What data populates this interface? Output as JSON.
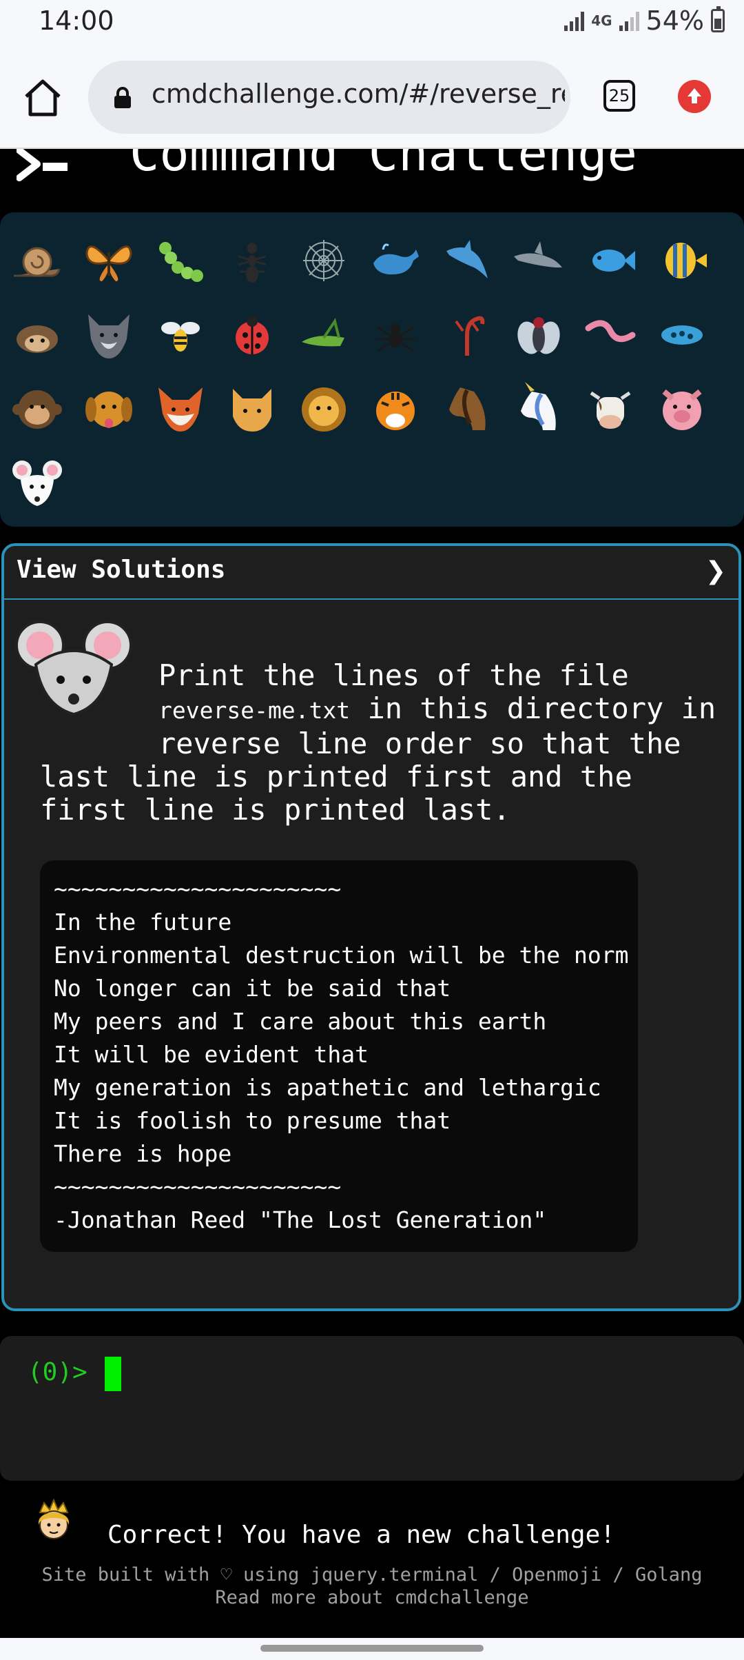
{
  "status_bar": {
    "time": "14:00",
    "network": "4G",
    "battery": "54%"
  },
  "browser": {
    "url": "cmdchallenge.com/#/reverse_reac",
    "tab_count": "25",
    "icons": [
      "home-icon",
      "lock-icon",
      "tab-switcher-icon",
      "update-icon"
    ]
  },
  "header": {
    "title": "Command Challenge"
  },
  "emoji_panel": {
    "items": [
      "snail",
      "butterfly",
      "caterpillar",
      "ant",
      "spider-web",
      "whale",
      "dolphin",
      "shark",
      "fish",
      "tropical-fish",
      "hedgehog",
      "wolf",
      "bee",
      "ladybug",
      "grasshopper",
      "spider",
      "scorpion",
      "fly",
      "worm",
      "microbe",
      "monkey",
      "dog",
      "fox",
      "cat",
      "lion",
      "tiger",
      "horse",
      "unicorn",
      "cow",
      "pig",
      "mouse"
    ]
  },
  "challenge": {
    "view_solutions": "View Solutions",
    "chevron": "❯",
    "instruction_line1": "Print the lines of the file",
    "instruction_code": "reverse-me.txt",
    "instruction_line2_rest": " in this directory in",
    "instruction_line3": "reverse line order so that the",
    "instruction_line4": "last line is printed first and the",
    "instruction_line5": "first line is printed last.",
    "file_lines": [
      "~~~~~~~~~~~~~~~~~~~~~",
      "In the future",
      "Environmental destruction will be the norm",
      "No longer can it be said that",
      "My peers and I care about this earth",
      "It will be evident that",
      "My generation is apathetic and lethargic",
      "It is foolish to presume that",
      "There is hope",
      "~~~~~~~~~~~~~~~~~~~~~",
      "-Jonathan Reed \"The Lost Generation\""
    ]
  },
  "terminal": {
    "prompt": "(0)>"
  },
  "message": {
    "text": "Correct! You have a new challenge!"
  },
  "footer": {
    "line1": "Site built with ♡ using jquery.terminal / Openmoji / Golang",
    "line2": "Read more about cmdchallenge"
  }
}
